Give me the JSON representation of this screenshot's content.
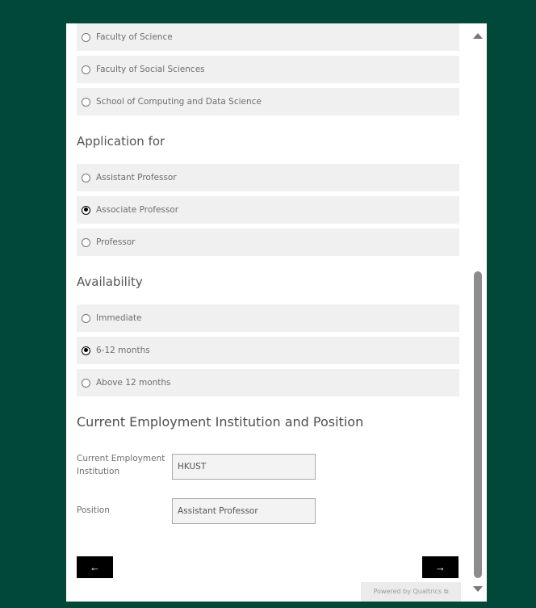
{
  "faculty_options": [
    {
      "label": "Faculty of Science",
      "checked": false
    },
    {
      "label": "Faculty of Social Sciences",
      "checked": false
    },
    {
      "label": "School of Computing and Data Science",
      "checked": false
    }
  ],
  "application": {
    "title": "Application for",
    "options": [
      {
        "label": "Assistant Professor",
        "checked": false
      },
      {
        "label": "Associate Professor",
        "checked": true
      },
      {
        "label": "Professor",
        "checked": false
      }
    ]
  },
  "availability": {
    "title": "Availability",
    "options": [
      {
        "label": "Immediate",
        "checked": false
      },
      {
        "label": "6-12 months",
        "checked": true
      },
      {
        "label": "Above 12 months",
        "checked": false
      }
    ]
  },
  "employment": {
    "title": "Current Employment Institution and Position",
    "institution_label": "Current Employment Institution",
    "institution_value": "HKUST",
    "position_label": "Position",
    "position_value": "Assistant Professor"
  },
  "nav": {
    "back_label": "←",
    "next_label": "→"
  },
  "footer": {
    "powered_by": "Powered by Qualtrics ⧉"
  }
}
